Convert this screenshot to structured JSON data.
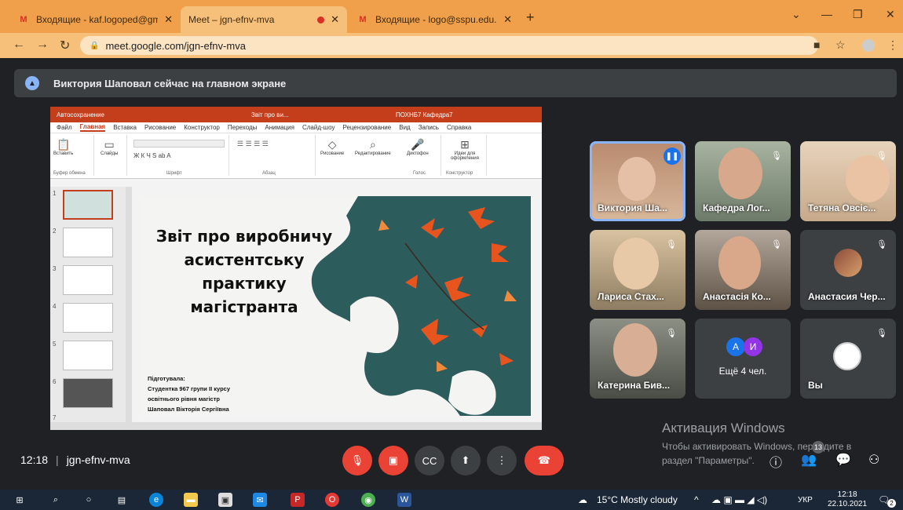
{
  "browser": {
    "tabs": [
      {
        "title": "Входящие - kaf.logoped@gmail.",
        "icon": "gmail-icon"
      },
      {
        "title": "Meet – jgn-efnv-mva",
        "icon": "meet-icon"
      },
      {
        "title": "Входящие - logo@sspu.edu.ua -",
        "icon": "gmail-icon"
      }
    ],
    "url": "meet.google.com/jgn-efnv-mva"
  },
  "banner": {
    "text": "Виктория Шаповал сейчас на главном экране"
  },
  "ppt": {
    "autosave": "Автосохранение",
    "doc_title": "Звіт про ви...",
    "user": "ПОХНБ7 Кафедра7",
    "menu": [
      "Файл",
      "Главная",
      "Вставка",
      "Рисование",
      "Конструктор",
      "Переходы",
      "Анимация",
      "Слайд-шоу",
      "Рецензирование",
      "Вид",
      "Запись",
      "Справка"
    ],
    "ribbon": {
      "paste": "Вставить",
      "slides": "Слайды",
      "clipboard": "Буфер обмена",
      "font": "Шрифт",
      "paragraph": "Абзац",
      "drawing": "Рисование",
      "editing": "Редактирование",
      "dictate": "Диктофон",
      "designer": "Идеи для оформления",
      "voice": "Голос",
      "designer_group": "Конструктор"
    },
    "thumbnails": [
      "1",
      "2",
      "3",
      "4",
      "5",
      "6",
      "7"
    ],
    "slide": {
      "title_lines": [
        "Звіт про виробничу",
        "асистентську",
        "практику",
        "магістранта"
      ],
      "author_lines": [
        "Підготувала:",
        "Студентка 967 групи ІІ курсу",
        "освітнього рівня магістр",
        "Шаповал Вікторія Сергіївна"
      ]
    }
  },
  "participants": [
    {
      "name": "Виктория Ша...",
      "speaking": true
    },
    {
      "name": "Кафедра Лог...",
      "muted": true
    },
    {
      "name": "Тетяна Овсіє...",
      "muted": true
    },
    {
      "name": "Лариса Стах...",
      "muted": true
    },
    {
      "name": "Анастасія Ко...",
      "muted": true
    },
    {
      "name": "Анастасия Чер...",
      "muted": true
    },
    {
      "name": "Катерина Бив...",
      "muted": true
    },
    {
      "name": "Ещё 4 чел.",
      "initials": [
        "А",
        "И"
      ]
    },
    {
      "name": "Вы",
      "muted": true
    }
  ],
  "watermark": {
    "title": "Активация Windows",
    "line1": "Чтобы активировать Windows, перейдите в",
    "line2": "раздел \"Параметры\"."
  },
  "bottom": {
    "time": "12:18",
    "meeting_code": "jgn-efnv-mva",
    "people_badge": "13"
  },
  "taskbar": {
    "weather": "15°C  Mostly cloudy",
    "lang": "УКР",
    "time": "12:18",
    "date": "22.10.2021",
    "notifications": "2"
  }
}
